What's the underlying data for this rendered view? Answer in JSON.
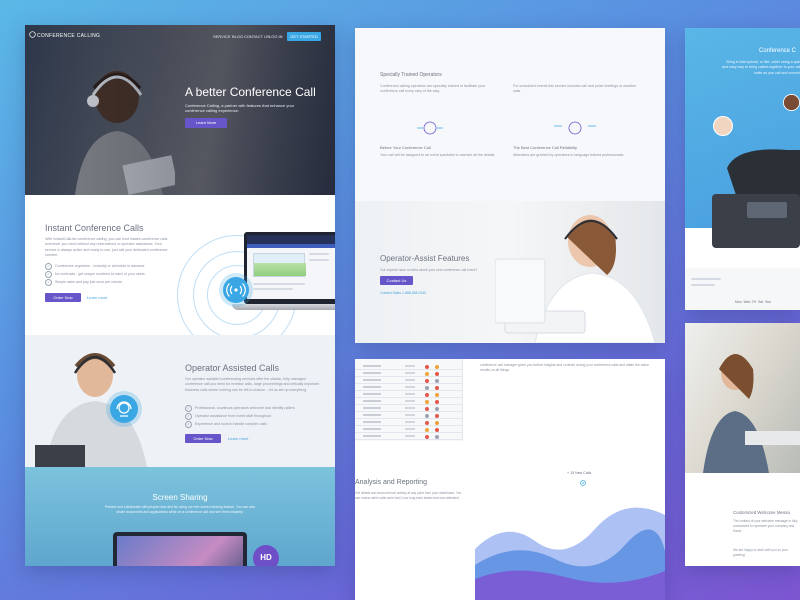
{
  "panel1": {
    "nav": {
      "brand": "CONFERENCE CALLING",
      "links": [
        "SERVICE",
        "BLOG",
        "CONTACT US",
        "LOG IN"
      ],
      "cta": "GET STARTED"
    },
    "hero": {
      "title": "A better Conference Call",
      "subtitle": "Conference Calling, a partner with features that enhance your conference calling experience.",
      "button": "Learn More"
    },
    "instant": {
      "title": "Instant Conference Calls",
      "body": "With InstantCallUse conference calling, you can host instant conference calls whenever you need without any reservations or operator assistance. Your service is always active and ready to use, just call your dedicated conference number.",
      "checks": [
        "Conference anywhere - instantly or schedule in advance",
        "No contracts - get unique numbers to each of your users",
        "Simple rates and pay just once per minute"
      ],
      "order_button": "Order Now",
      "link": "Learn more"
    },
    "operator": {
      "title": "Operator Assisted Calls",
      "body": "Our operator assisted conferencing services offer the classic, fully managed conference call you need for investor calls, large proceedings and critically important business calls where nothing can be left to chance – let us set up everything.",
      "checks": [
        "Professional, courteous operators welcome and identify callers",
        "Operator assistance from event staff throughout",
        "Experience and tools to handle complex calls"
      ],
      "order_button": "Order Now",
      "link": "Learn more"
    },
    "screen_sharing": {
      "title": "Screen Sharing",
      "body": "Present and collaborate with people near and far using our free screen sharing feature. You can also share documents and applications while on a conference call and see them instantly.",
      "badge": "HD"
    }
  },
  "panel2": {
    "section_title": "Specially Trained Operators",
    "intro_left": "Conference calling operators are specially trained to facilitate your conference call every step of the way.",
    "intro_right": "For scheduled events this service includes call and pulse briefings or weather calls.",
    "features": [
      {
        "title": "Before Your Conference Call",
        "body": "Your call will be assigned to an event specialist to oversee all the details."
      },
      {
        "title": "The Best Conference Call Reliability",
        "body": "Attendees are greeted by operators in language trained professionals."
      }
    ],
    "operator_features": {
      "title": "Operator-Assist Features",
      "subtitle": "Our experts have no idea about your next conference call event?",
      "button": "Contact Us",
      "contact": "Contact Sales 1-888-555-0140"
    }
  },
  "panel3": {
    "right_text": "conference call manager gives you further insights and controls during your conference calls and attain the same results on all things.",
    "analysis_title": "Analysis and Reporting",
    "analysis_body": "Get details and account level activity at any point from your dashboard. You can review when calls were held, how long each lasted and who attended.",
    "new_calls": "+ 15 New Calls"
  },
  "panel4": {
    "title": "Conference C",
    "body": "Bring in that special, or like, caller using a quick and easy way to bring callers together to your call. Invite as you call and connect.",
    "tabs": [
      "Mon",
      "Wed",
      "Fri",
      "Sat",
      "Sun"
    ]
  },
  "panel5": {
    "title": "Customized Welcome Messa",
    "body": "The content of your welcome message is fully customized to represent your company and brand.",
    "body2": "We are happy to work with you on your greeting."
  },
  "colors": {
    "accent_purple": "#6756c9",
    "accent_blue": "#3aa7e4",
    "background_start": "#5ab8e6",
    "background_end": "#7d56d2"
  }
}
